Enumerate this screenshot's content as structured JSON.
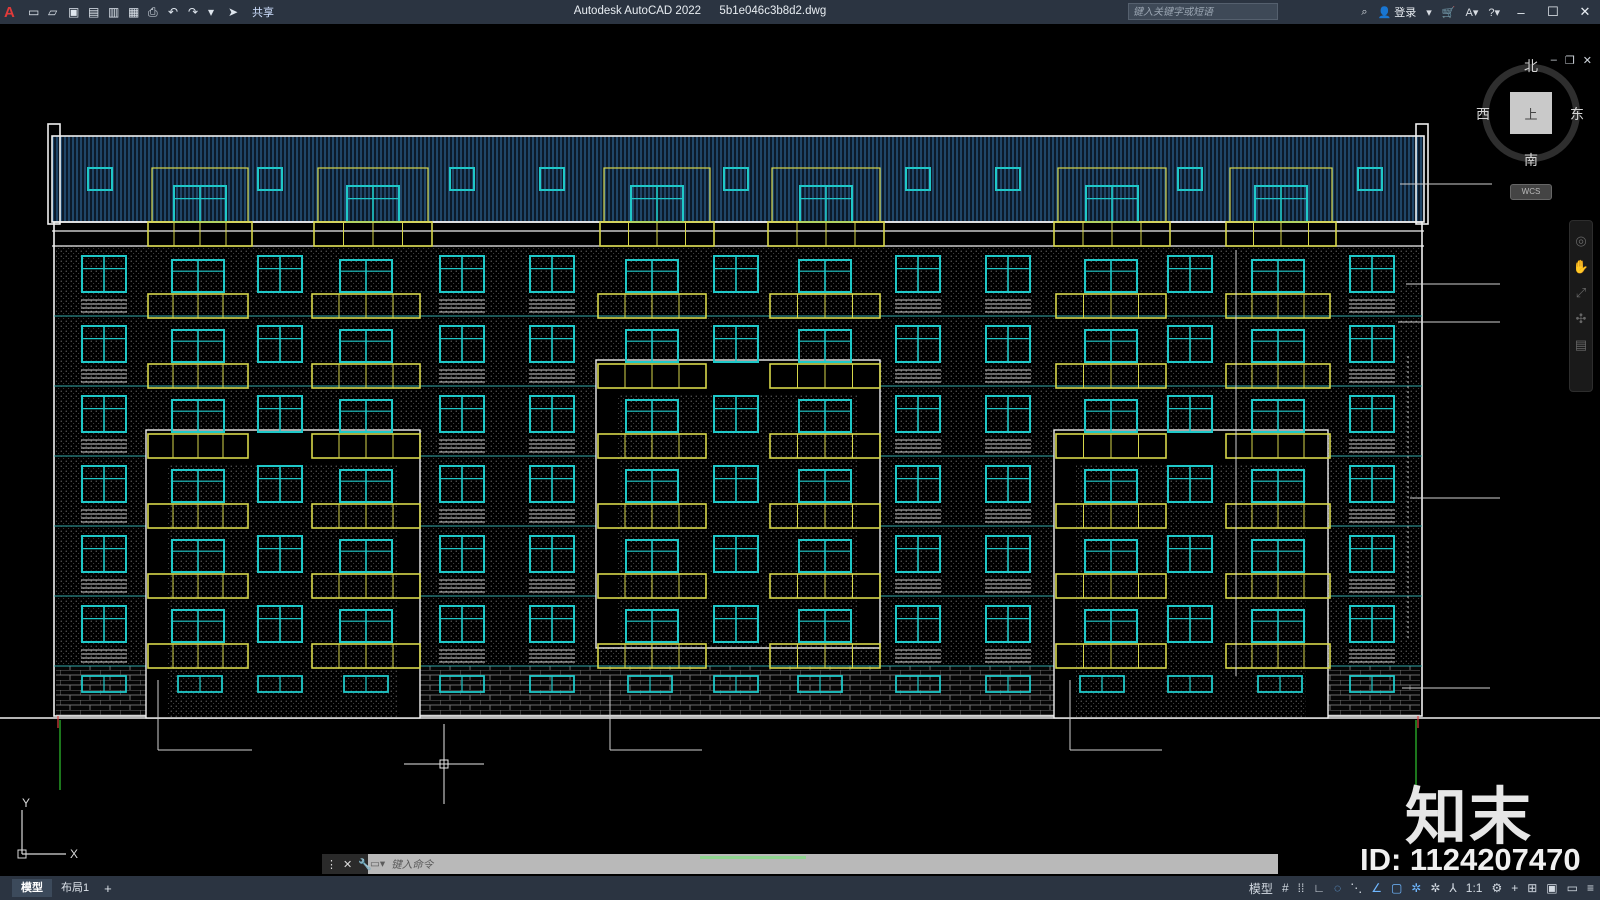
{
  "app": {
    "title": "Autodesk AutoCAD 2022",
    "filename": "5b1e046c3b8d2.dwg",
    "share_label": "共享",
    "search_placeholder": "键入关键字或短语",
    "login_label": "登录"
  },
  "viewcube": {
    "north": "北",
    "south": "南",
    "west": "西",
    "east": "东",
    "face": "上",
    "wcs": "WCS"
  },
  "ucs": {
    "x": "X",
    "y": "Y"
  },
  "command": {
    "placeholder": "键入命令"
  },
  "tabs": [
    {
      "label": "模型"
    },
    {
      "label": "布局1"
    }
  ],
  "status": {
    "model_label": "模型",
    "scale": "1:1"
  },
  "watermark": {
    "logo_text": "知末",
    "id_text": "ID: 1124207470"
  },
  "colors": {
    "window_cyan": "#1fc8c8",
    "balcony_yellow": "#d6d64a",
    "wall_white": "#f0f0f0",
    "roof_blue": "#2a5a86",
    "titlebar": "#2b3441"
  }
}
